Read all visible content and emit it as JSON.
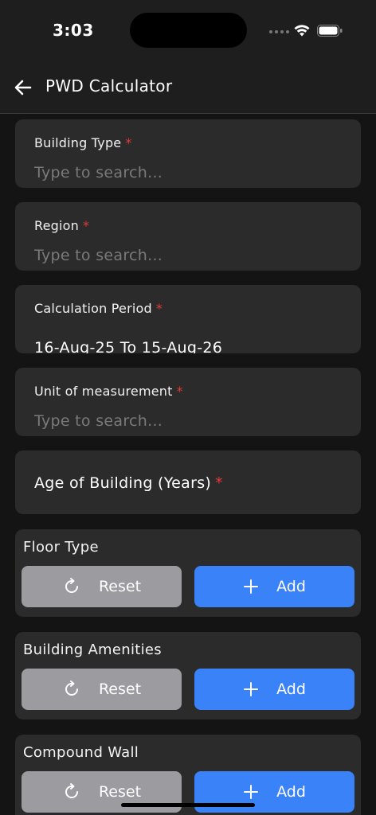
{
  "status_bar": {
    "time": "3:03"
  },
  "app_bar": {
    "title": "PWD Calculator"
  },
  "fields": {
    "building_type": {
      "label": "Building Type",
      "required": "*",
      "placeholder": "Type to search..."
    },
    "region": {
      "label": "Region",
      "required": "*",
      "placeholder": "Type to search..."
    },
    "calculation_period": {
      "label": "Calculation Period",
      "required": "*",
      "value": "16-Aug-25 To 15-Aug-26"
    },
    "unit_of_measurement": {
      "label": "Unit of measurement",
      "required": "*",
      "placeholder": "Type to search..."
    },
    "age_of_building": {
      "label": "Age of Building (Years)",
      "required": "*"
    }
  },
  "sections": [
    {
      "title": "Floor Type",
      "reset_label": "Reset",
      "add_label": "Add"
    },
    {
      "title": "Building Amenities",
      "reset_label": "Reset",
      "add_label": "Add"
    },
    {
      "title": "Compound Wall",
      "reset_label": "Reset",
      "add_label": "Add"
    }
  ],
  "colors": {
    "background": "#141414",
    "card": "#2b2b2b",
    "primary": "#3a82f7",
    "secondary": "#9b9ba0",
    "required": "#e53935"
  },
  "icons": {
    "back": "arrow-left-icon",
    "reset": "refresh-icon",
    "add": "plus-icon",
    "wifi": "wifi-icon",
    "battery": "battery-icon"
  }
}
